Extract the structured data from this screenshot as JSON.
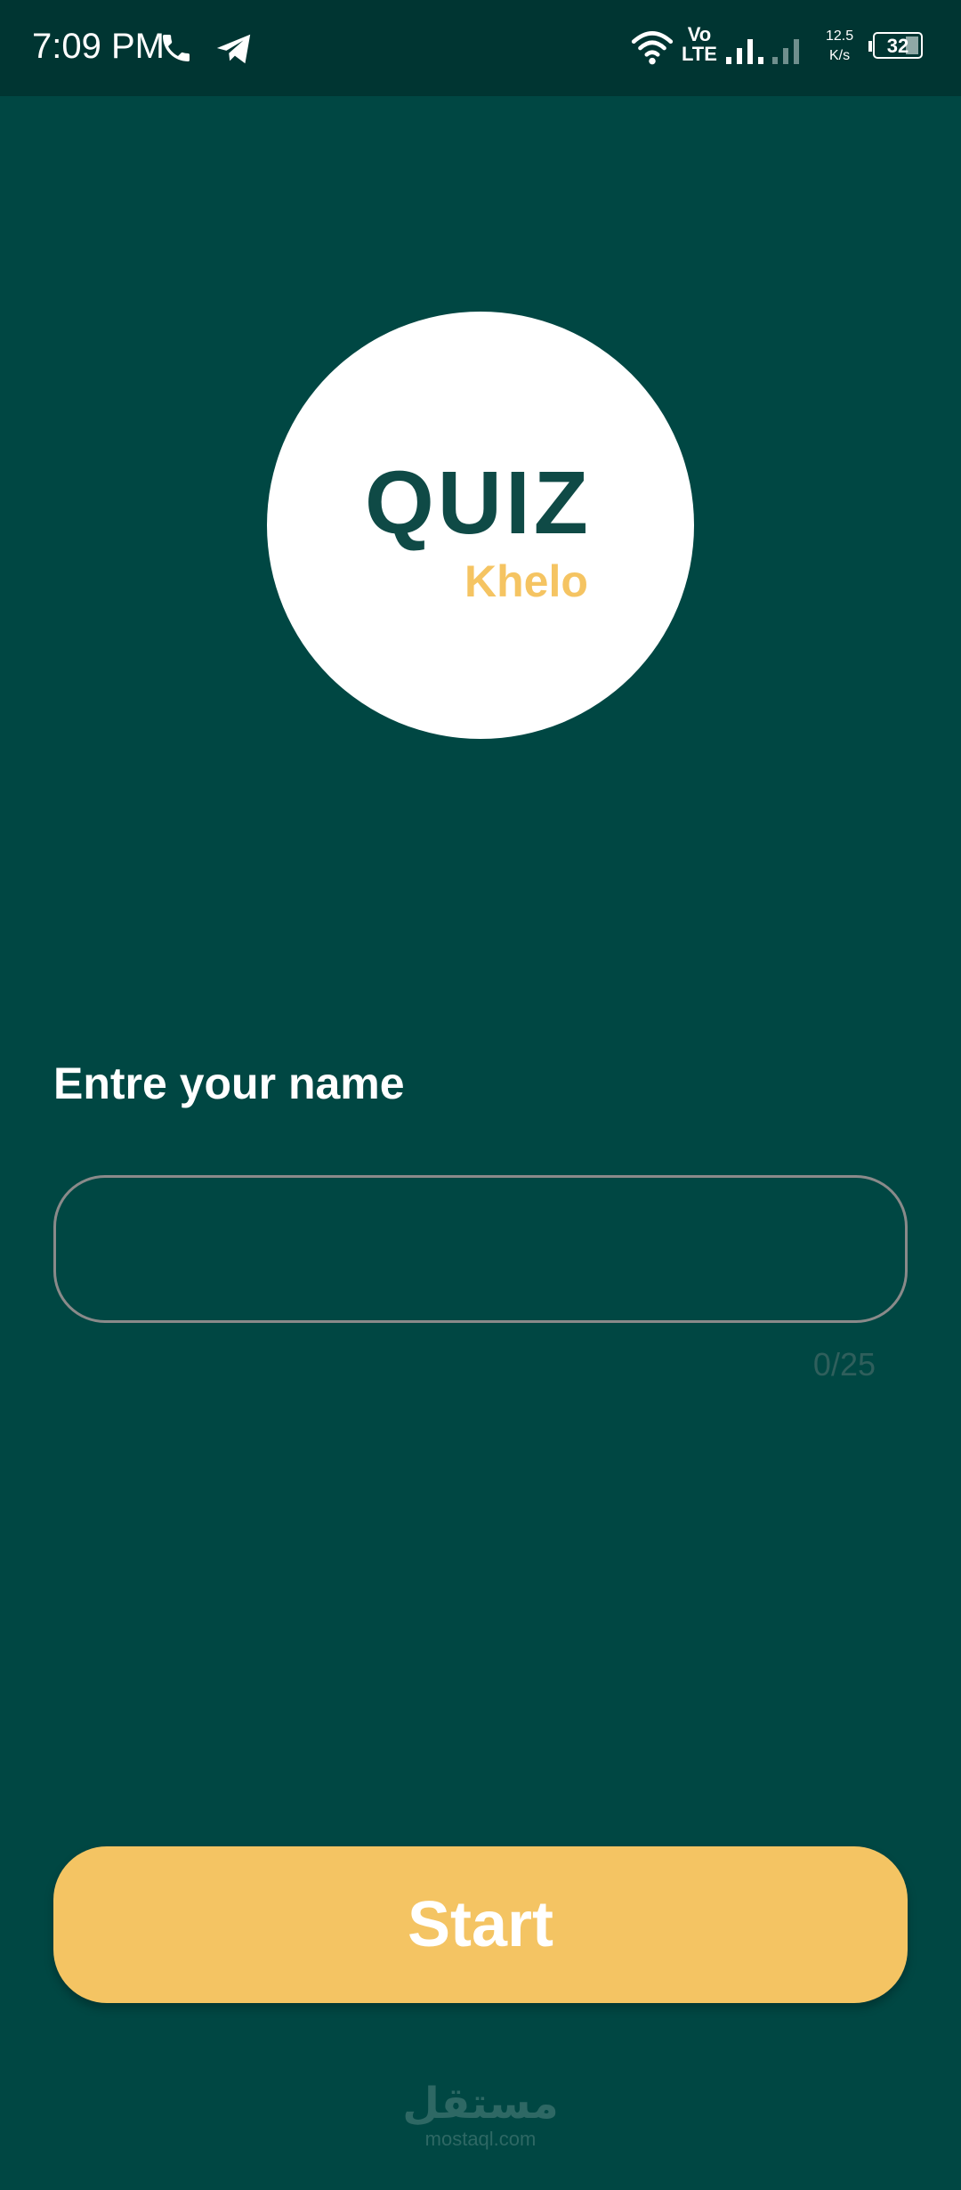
{
  "status_bar": {
    "time": "7:09 PM",
    "network_top": "Vo",
    "network_bottom": "LTE",
    "speed_value": "12.5",
    "speed_unit": "K/s",
    "battery": "32"
  },
  "logo": {
    "title": "QUIZ",
    "subtitle": "Khelo"
  },
  "form": {
    "label": "Entre your name",
    "input_value": "",
    "counter": "0/25"
  },
  "start_button": {
    "label": "Start"
  },
  "watermark": {
    "arabic": "مستقل",
    "domain": "mostaql.com"
  },
  "colors": {
    "background": "#004743",
    "status_bar": "#003532",
    "accent": "#f4c463",
    "logo_text": "#0f4a46"
  },
  "icons": [
    "phone-icon",
    "telegram-icon",
    "wifi-icon",
    "signal-icon",
    "battery-icon"
  ]
}
